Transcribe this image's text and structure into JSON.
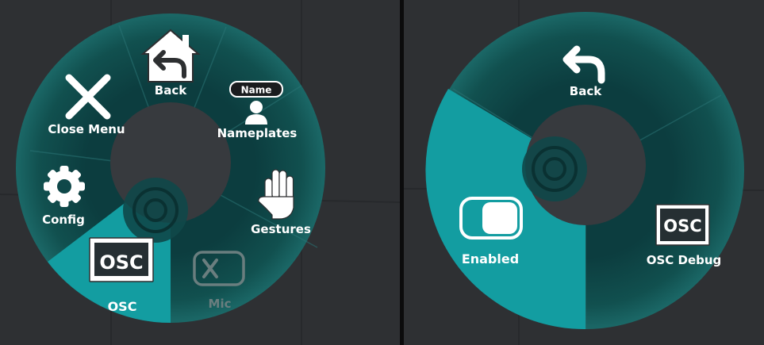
{
  "left_menu": {
    "items": {
      "back": "Back",
      "close_menu": "Close Menu",
      "nameplates": "Nameplates",
      "nameplate_tag": "Name",
      "config": "Config",
      "gestures": "Gestures",
      "osc": "OSC",
      "osc_icon_text": "OSC",
      "mic": "Mic"
    },
    "selected_item": "OSC",
    "disabled_items": [
      "Mic"
    ]
  },
  "right_menu": {
    "items": {
      "back": "Back",
      "enabled": "Enabled",
      "osc_debug": "OSC Debug",
      "osc_icon_text": "OSC"
    },
    "enabled_toggle_on": true,
    "selected_item": "Enabled"
  },
  "colors": {
    "ring": "#0d4446",
    "ring_light": "#185f60",
    "center": "#373a3e",
    "highlight": "#139da1",
    "text": "#ffffff",
    "disabled": "#6a7e7f",
    "background": "#2e3033"
  }
}
